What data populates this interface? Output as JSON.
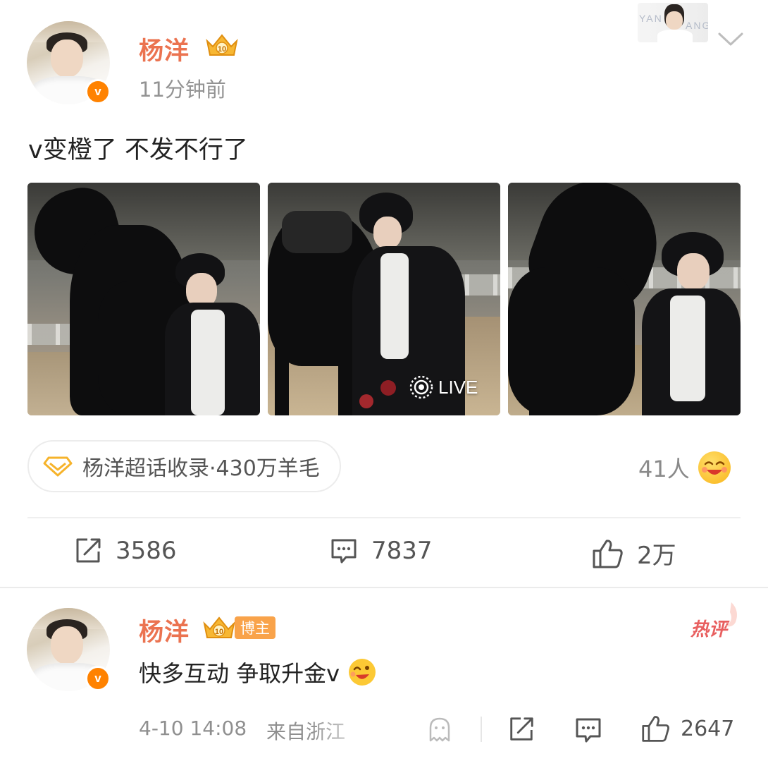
{
  "post": {
    "author": "杨洋",
    "verified_badge": "v",
    "time": "11分钟前",
    "banner_text_left": "YAN",
    "banner_text_right": "ANG",
    "text": "v变橙了 不发不行了",
    "images": [
      {
        "live": false
      },
      {
        "live": true,
        "live_label": "LIVE"
      },
      {
        "live": false
      }
    ],
    "topic": {
      "label": "杨洋超话收录·430万羊毛",
      "icon": "diamond-icon"
    },
    "reaction": {
      "count_label": "41人",
      "icon": "laughing-emoji-icon"
    },
    "actions": {
      "repost": "3586",
      "comment": "7837",
      "like": "2万"
    }
  },
  "comment": {
    "author": "杨洋",
    "blogger_tag": "博主",
    "hot_tag": "热评",
    "text": "快多互动 争取升金v",
    "emoji": "wink-emoji-icon",
    "date": "4-10 14:08",
    "source": "来自浙江",
    "like_count": "2647"
  },
  "colors": {
    "username": "#eb7350",
    "verified": "#ff8200",
    "blogger_tag": "#f9a34a",
    "hot_tag": "#e85f5f",
    "divider": "#efefef"
  }
}
